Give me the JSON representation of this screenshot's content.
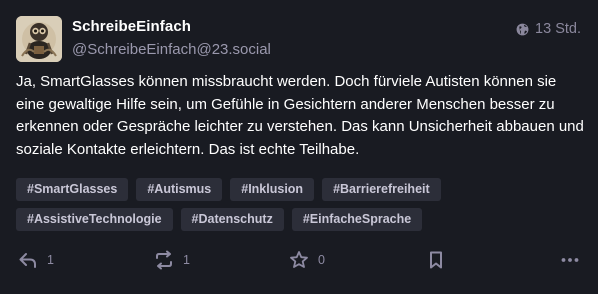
{
  "post": {
    "display_name": "SchreibeEinfach",
    "handle": "@SchreibeEinfach@23.social",
    "time": "13 Std.",
    "text": "Ja, SmartGlasses können missbraucht werden. Doch fürviele Autisten können sie eine gewaltige Hilfe sein, um Gefühle in Gesichtern anderer Menschen besser zu erkennen oder Gespräche leichter zu verstehen. Das kann Unsicherheit abbauen und soziale Kontakte erleichtern. Das ist echte Teilhabe.",
    "tags": [
      "#SmartGlasses",
      "#Autismus",
      "#Inklusion",
      "#Barrierefreiheit",
      "#AssistiveTechnologie",
      "#Datenschutz",
      "#EinfacheSprache"
    ]
  },
  "actions": {
    "reply_count": "1",
    "boost_count": "1",
    "favourite_count": "0"
  },
  "icons": {
    "visibility": "globe-icon",
    "reply": "reply-icon",
    "boost": "boost-icon",
    "favourite": "star-icon",
    "bookmark": "bookmark-icon",
    "more": "more-icon"
  },
  "colors": {
    "background": "#191b22",
    "tag_background": "#2c2e39",
    "muted_text": "#9a98ad",
    "icon": "#8d8aa2"
  }
}
